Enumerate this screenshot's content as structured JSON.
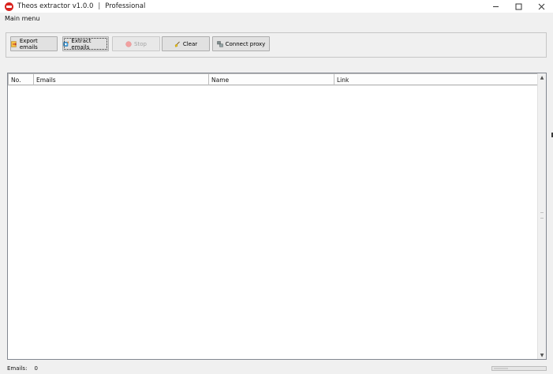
{
  "window": {
    "title": "Theos extractor v1.0.0",
    "separator": "|",
    "edition": "Professional",
    "accent": "#d9231f"
  },
  "menu": {
    "items": [
      {
        "label": "Main menu"
      }
    ]
  },
  "toolbar": {
    "buttons": [
      {
        "label": "Export emails",
        "icon": "export-icon",
        "enabled": true
      },
      {
        "label": "Extract emails",
        "icon": "extract-icon",
        "enabled": true,
        "focused": true
      },
      {
        "label": "Stop",
        "icon": "stop-icon",
        "enabled": false
      },
      {
        "label": "Clear",
        "icon": "clear-icon",
        "enabled": true
      },
      {
        "label": "Connect proxy",
        "icon": "proxy-icon",
        "enabled": true
      }
    ]
  },
  "table": {
    "columns": [
      "No.",
      "Emails",
      "Name",
      "Link"
    ],
    "rows": []
  },
  "status": {
    "emails_label": "Emails:",
    "emails_count": "0",
    "progress": 0
  }
}
